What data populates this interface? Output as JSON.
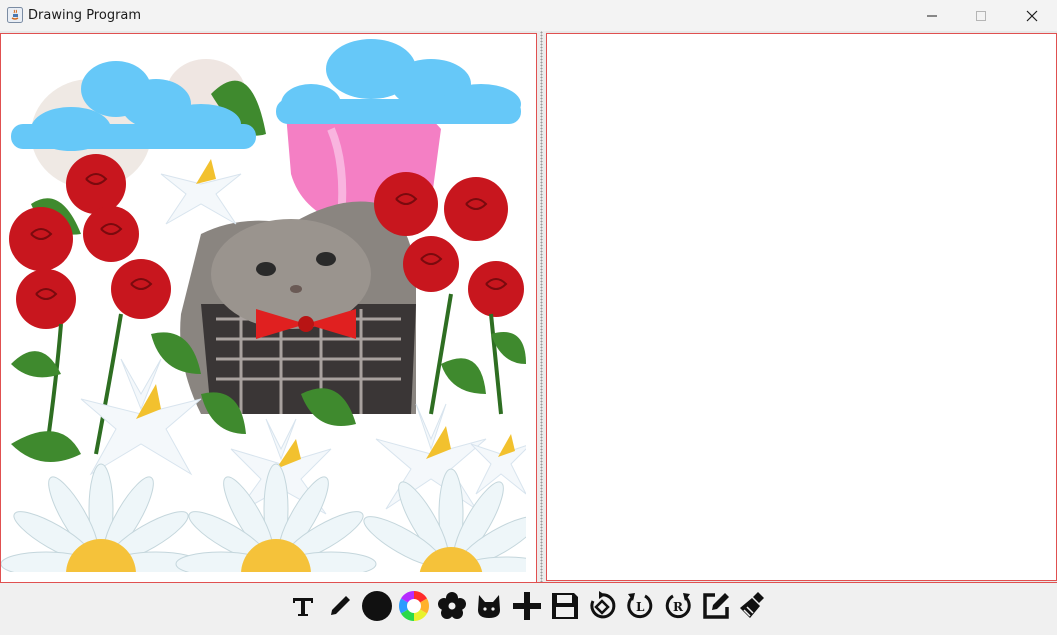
{
  "window": {
    "title": "Drawing Program",
    "controls": [
      "minimize-icon",
      "maximize-icon",
      "close-icon"
    ]
  },
  "left_canvas": {
    "content": [
      "cloud",
      "cloud",
      "cat-photo",
      "roses",
      "lilies",
      "daisies"
    ],
    "colors": {
      "cloud": "#66c8f8",
      "rose": "#c8161e",
      "leaf": "#3f8a2e",
      "lily": "#f4f8fb",
      "daisy_center": "#f5c23a",
      "bowtie": "#e02020"
    }
  },
  "right_canvas": {
    "content": []
  },
  "toolbar": {
    "tools": [
      {
        "name": "text-tool",
        "icon": "text-icon"
      },
      {
        "name": "pencil-tool",
        "icon": "pencil-icon"
      },
      {
        "name": "brush-size-tool",
        "icon": "filled-circle-icon"
      },
      {
        "name": "color-picker-tool",
        "icon": "color-wheel-icon"
      },
      {
        "name": "flower-stamp-tool",
        "icon": "flower-icon"
      },
      {
        "name": "cat-stamp-tool",
        "icon": "cat-icon"
      },
      {
        "name": "add-tool",
        "icon": "plus-icon"
      },
      {
        "name": "save-tool",
        "icon": "floppy-disk-icon"
      },
      {
        "name": "rotate-tool",
        "icon": "rotate-icon"
      },
      {
        "name": "rotate-left-tool",
        "icon": "rotate-left-icon"
      },
      {
        "name": "rotate-right-tool",
        "icon": "rotate-right-icon"
      },
      {
        "name": "edit-tool",
        "icon": "edit-icon"
      },
      {
        "name": "clear-tool",
        "icon": "broom-icon"
      }
    ],
    "accent": "#e05050"
  }
}
